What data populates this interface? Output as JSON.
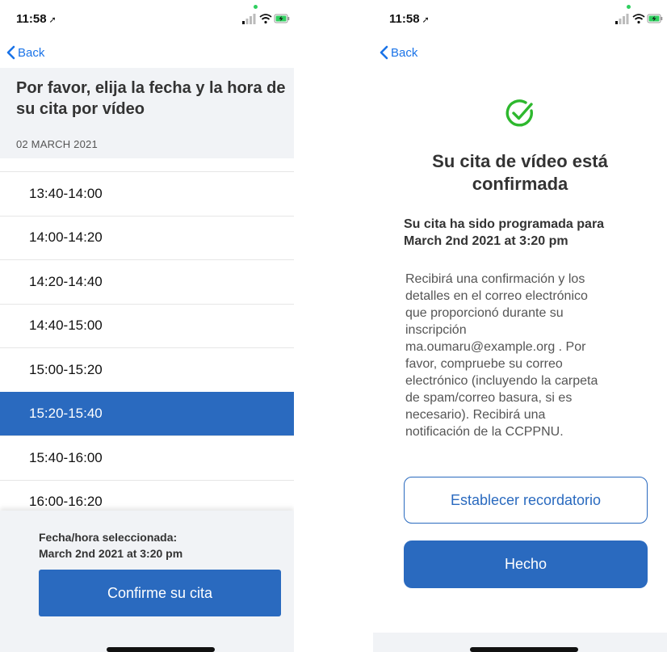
{
  "status": {
    "time": "11:58",
    "location_glyph": "➚"
  },
  "colors": {
    "accent": "#2a6abf",
    "link": "#1a73e8",
    "success": "#2eb82e",
    "panel": "#f1f3f6"
  },
  "left": {
    "back_label": "Back",
    "title": "Por favor, elija la fecha y la hora de su cita por vídeo",
    "date_header": "02 MARCH 2021",
    "slots": [
      "13:40-14:00",
      "14:00-14:20",
      "14:20-14:40",
      "14:40-15:00",
      "15:00-15:20",
      "15:20-15:40",
      "15:40-16:00",
      "16:00-16:20"
    ],
    "selected_slot_index": 5,
    "selected_label": "Fecha/hora seleccionada:",
    "selected_value": "March 2nd 2021 at 3:20 pm",
    "confirm_button": "Confirme su cita"
  },
  "right": {
    "back_label": "Back",
    "check_icon": "check-circle-icon",
    "title_line1": "Su cita de vídeo está",
    "title_line2": "confirmada",
    "scheduled_label": "Su cita ha sido programada para",
    "scheduled_value": "March 2nd 2021 at 3:20 pm",
    "message_lines": [
      "Recibirá una confirmación y los",
      "detalles en el correo electrónico",
      "que proporcionó durante su",
      "inscripción",
      "ma.oumaru@example.org . Por",
      "favor, compruebe su correo",
      "electrónico (incluyendo la carpeta",
      "de spam/correo basura, si es",
      "necesario). Recibirá una",
      "notificación de la CCPPNU."
    ],
    "reminder_button": "Establecer recordatorio",
    "done_button": "Hecho"
  }
}
